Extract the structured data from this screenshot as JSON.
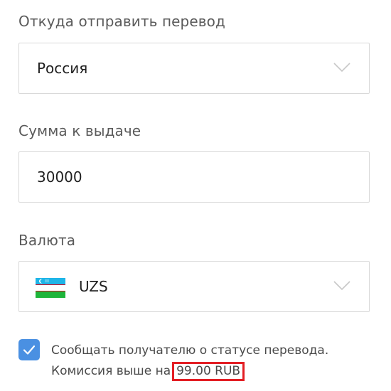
{
  "from": {
    "label": "Откуда отправить перевод",
    "value": "Россия"
  },
  "amount": {
    "label": "Сумма к выдаче",
    "value": "30000"
  },
  "currency": {
    "label": "Валюта",
    "value": "UZS",
    "flag_icon": "uzbekistan-flag-icon"
  },
  "notify": {
    "checked": true,
    "line1": "Сообщать получателю о статусе перевода.",
    "line2_prefix": "Комиссия выше на",
    "fee": "99.00 RUB"
  },
  "colors": {
    "accent": "#4a90e2",
    "highlight": "#e31e24"
  }
}
